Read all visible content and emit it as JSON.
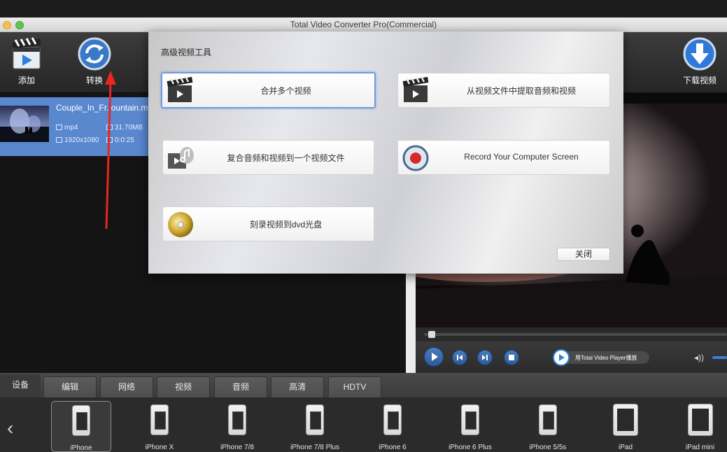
{
  "window": {
    "title": "Total Video Converter Pro(Commercial)"
  },
  "toolbar": {
    "add_label": "添加",
    "convert_label": "转换",
    "download_label": "下载视频"
  },
  "file": {
    "name": "Couple_In_Fr..ountain.m",
    "format": "mp4",
    "size": "31.70MB",
    "resolution": "1920x1080",
    "duration": "0:0:25"
  },
  "player": {
    "open_with_label": "用Total Video Player播放",
    "progress": 0.01
  },
  "modal": {
    "title": "高级视频工具",
    "tools": [
      {
        "label": "合并多个视频",
        "icon": "clapperboard-icon",
        "selected": true
      },
      {
        "label": "从视频文件中提取音频和视频",
        "icon": "clapperboard-icon",
        "selected": false
      },
      {
        "label": "复合音频和视频到一个视频文件",
        "icon": "audio-video-merge-icon",
        "selected": false
      },
      {
        "label": "Record Your Computer Screen",
        "icon": "record-icon",
        "selected": false
      },
      {
        "label": "刻录视频到dvd光盘",
        "icon": "dvd-disc-icon",
        "selected": false
      }
    ],
    "close_label": "关闭"
  },
  "tabs": [
    {
      "label": "设备",
      "active": true
    },
    {
      "label": "编辑"
    },
    {
      "label": "网络"
    },
    {
      "label": "视频"
    },
    {
      "label": "音频"
    },
    {
      "label": "高清"
    },
    {
      "label": "HDTV"
    }
  ],
  "devices": [
    {
      "label": "iPhone",
      "type": "phone",
      "selected": true
    },
    {
      "label": "iPhone X",
      "type": "phone"
    },
    {
      "label": "iPhone 7/8",
      "type": "phone"
    },
    {
      "label": "iPhone 7/8 Plus",
      "type": "phone"
    },
    {
      "label": "iPhone 6",
      "type": "phone"
    },
    {
      "label": "iPhone 6 Plus",
      "type": "phone"
    },
    {
      "label": "iPhone 5/5s",
      "type": "phone"
    },
    {
      "label": "iPad",
      "type": "tablet"
    },
    {
      "label": "iPad mini",
      "type": "tablet"
    }
  ],
  "colors": {
    "accent": "#5a88cf",
    "annotation": "#e8261f"
  }
}
